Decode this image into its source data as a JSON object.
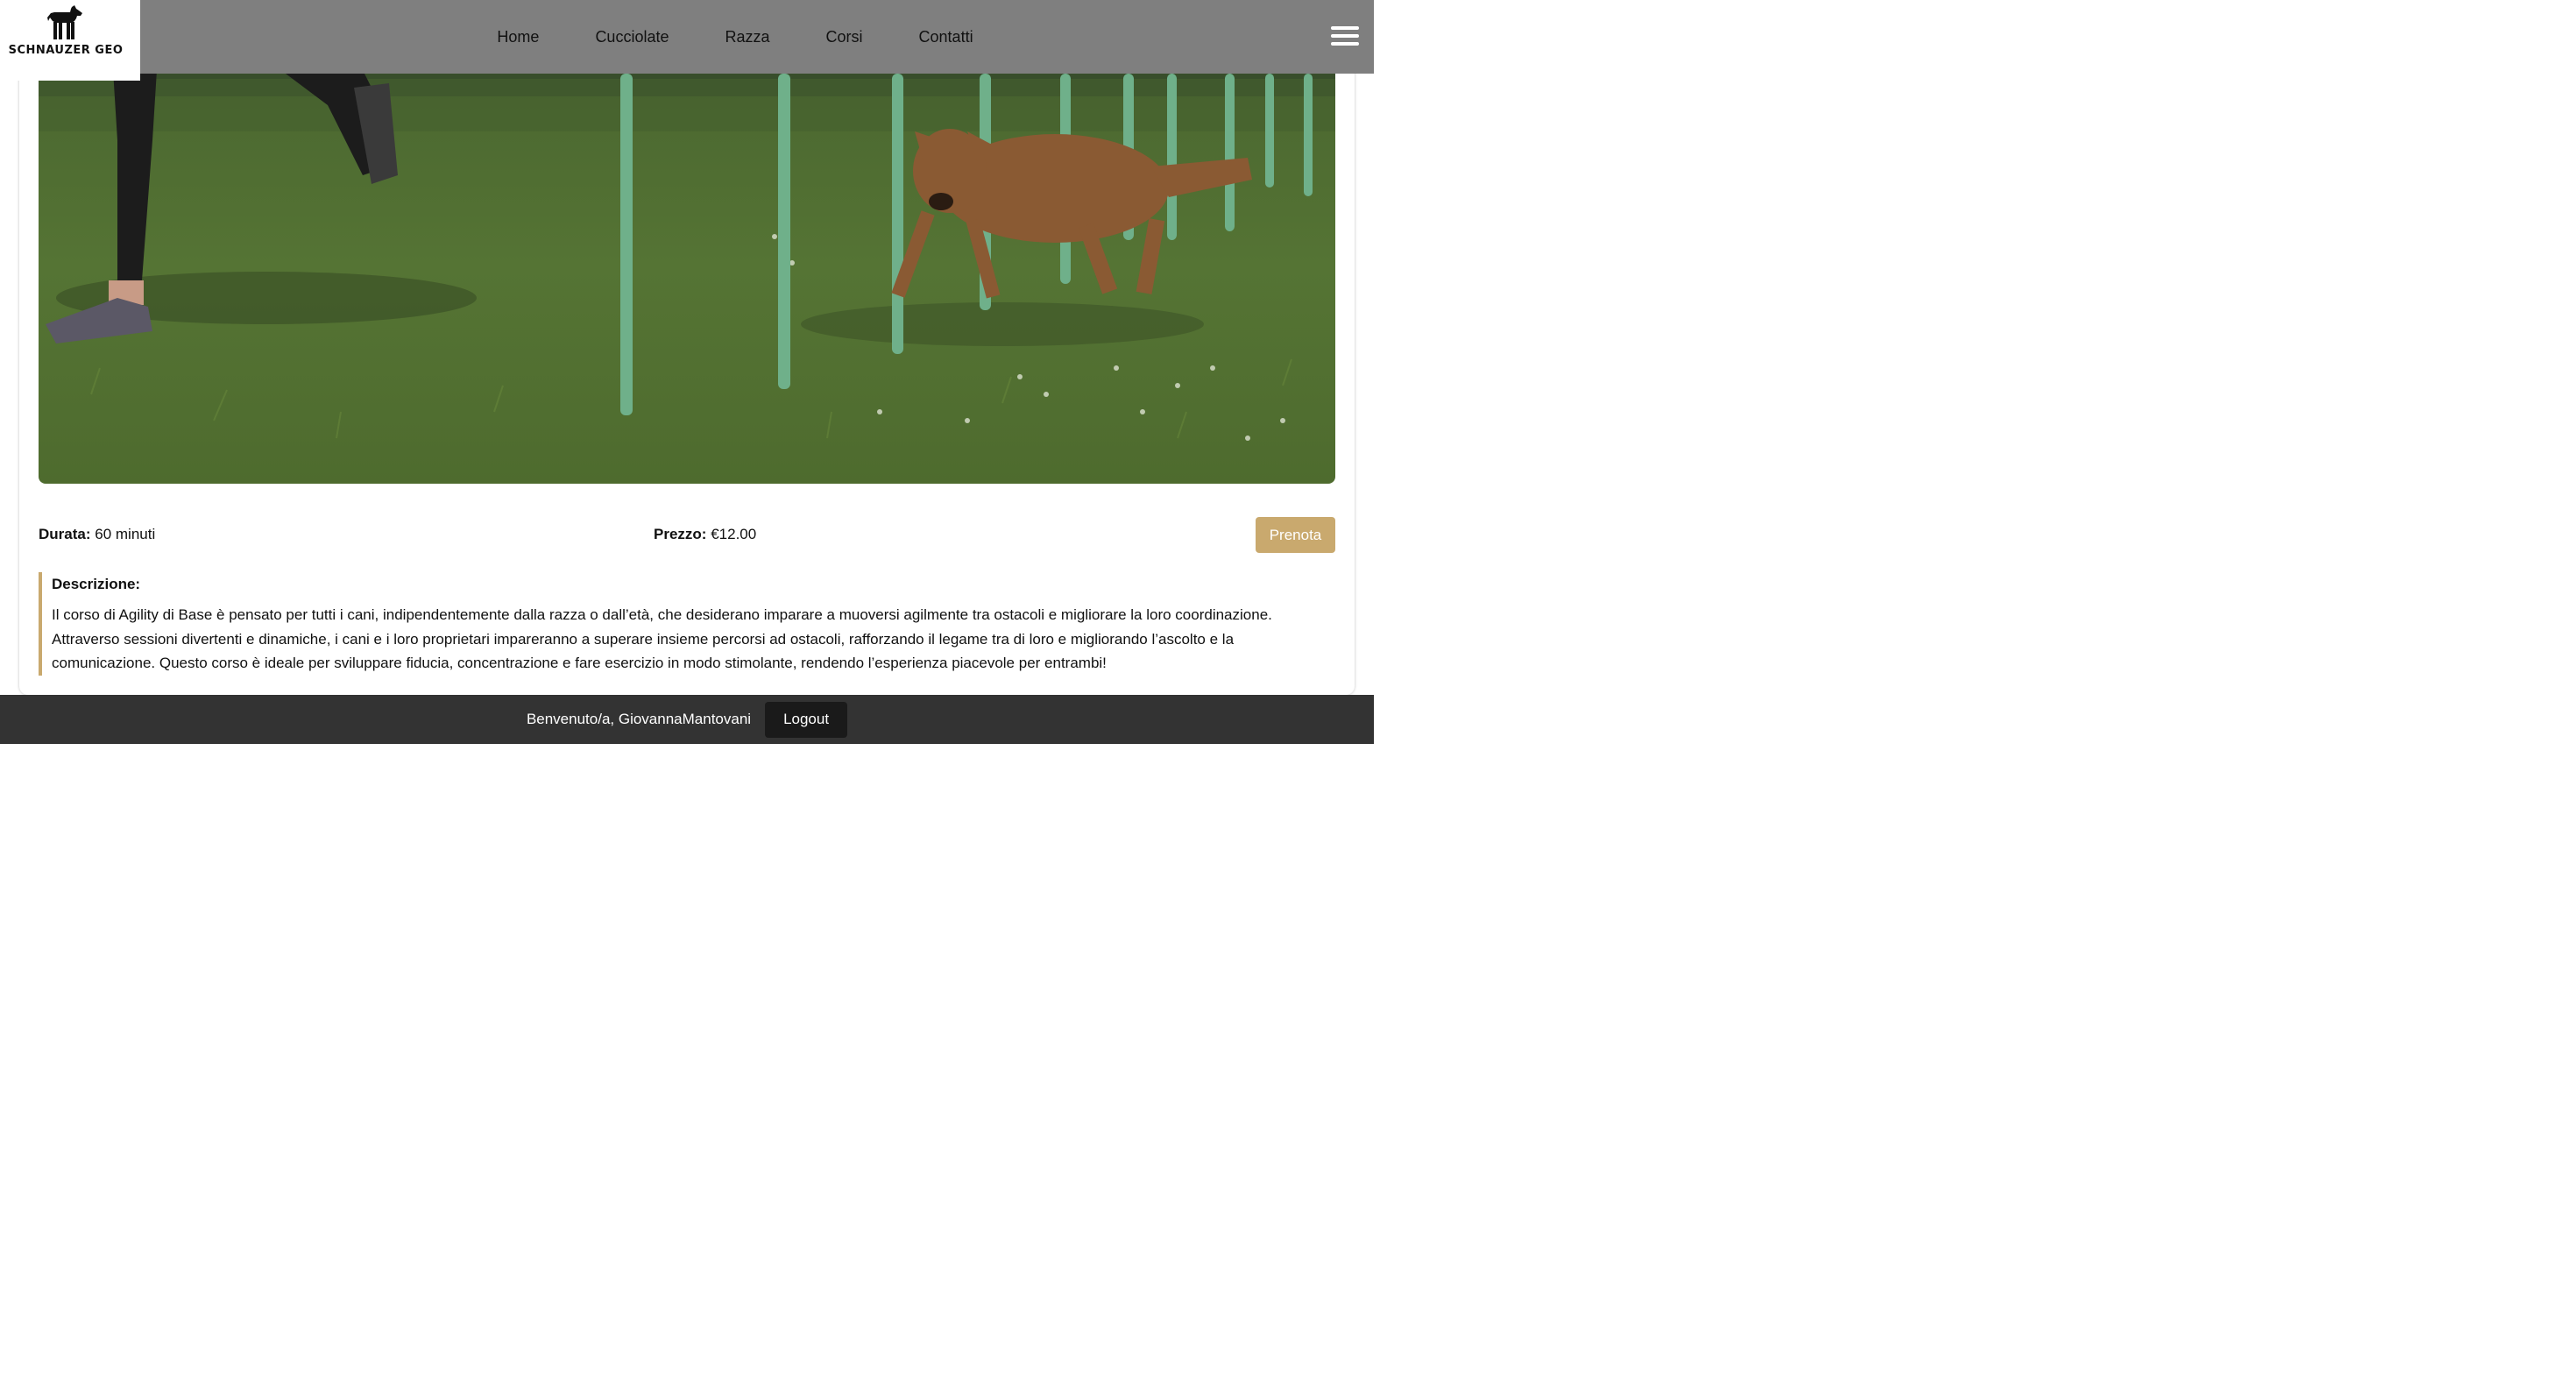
{
  "header": {
    "logo_text": "SCHNAUZER GEO",
    "nav_items": [
      "Home",
      "Cucciolate",
      "Razza",
      "Corsi",
      "Contatti"
    ],
    "menu_icon": "hamburger-icon"
  },
  "course": {
    "image_subject": "dog running through agility weave poles on grass",
    "durata_label": "Durata:",
    "durata_value": "60 minuti",
    "prezzo_label": "Prezzo:",
    "prezzo_value": "€12.00",
    "prenota_label": "Prenota",
    "description_title": "Descrizione:",
    "description_text": "Il corso di Agility di Base è pensato per tutti i cani, indipendentemente dalla razza o dall’età, che desiderano imparare a muoversi agilmente tra ostacoli e migliorare la loro coordinazione. Attraverso sessioni divertenti e dinamiche, i cani e i loro proprietari impareranno a superare insieme percorsi ad ostacoli, rafforzando il legame tra di loro e migliorando l’ascolto e la comunicazione. Questo corso è ideale per sviluppare fiducia, concentrazione e fare esercizio in modo stimolante, rendendo l’esperienza piacevole per entrambi!"
  },
  "footer": {
    "welcome_text": "Benvenuto/a, GiovannaMantovani",
    "logout_label": "Logout"
  },
  "colors": {
    "header_bg": "#7f7f7f",
    "accent": "#c9a96e",
    "footer_bg": "#333333",
    "logout_bg": "#1a1a1a"
  }
}
